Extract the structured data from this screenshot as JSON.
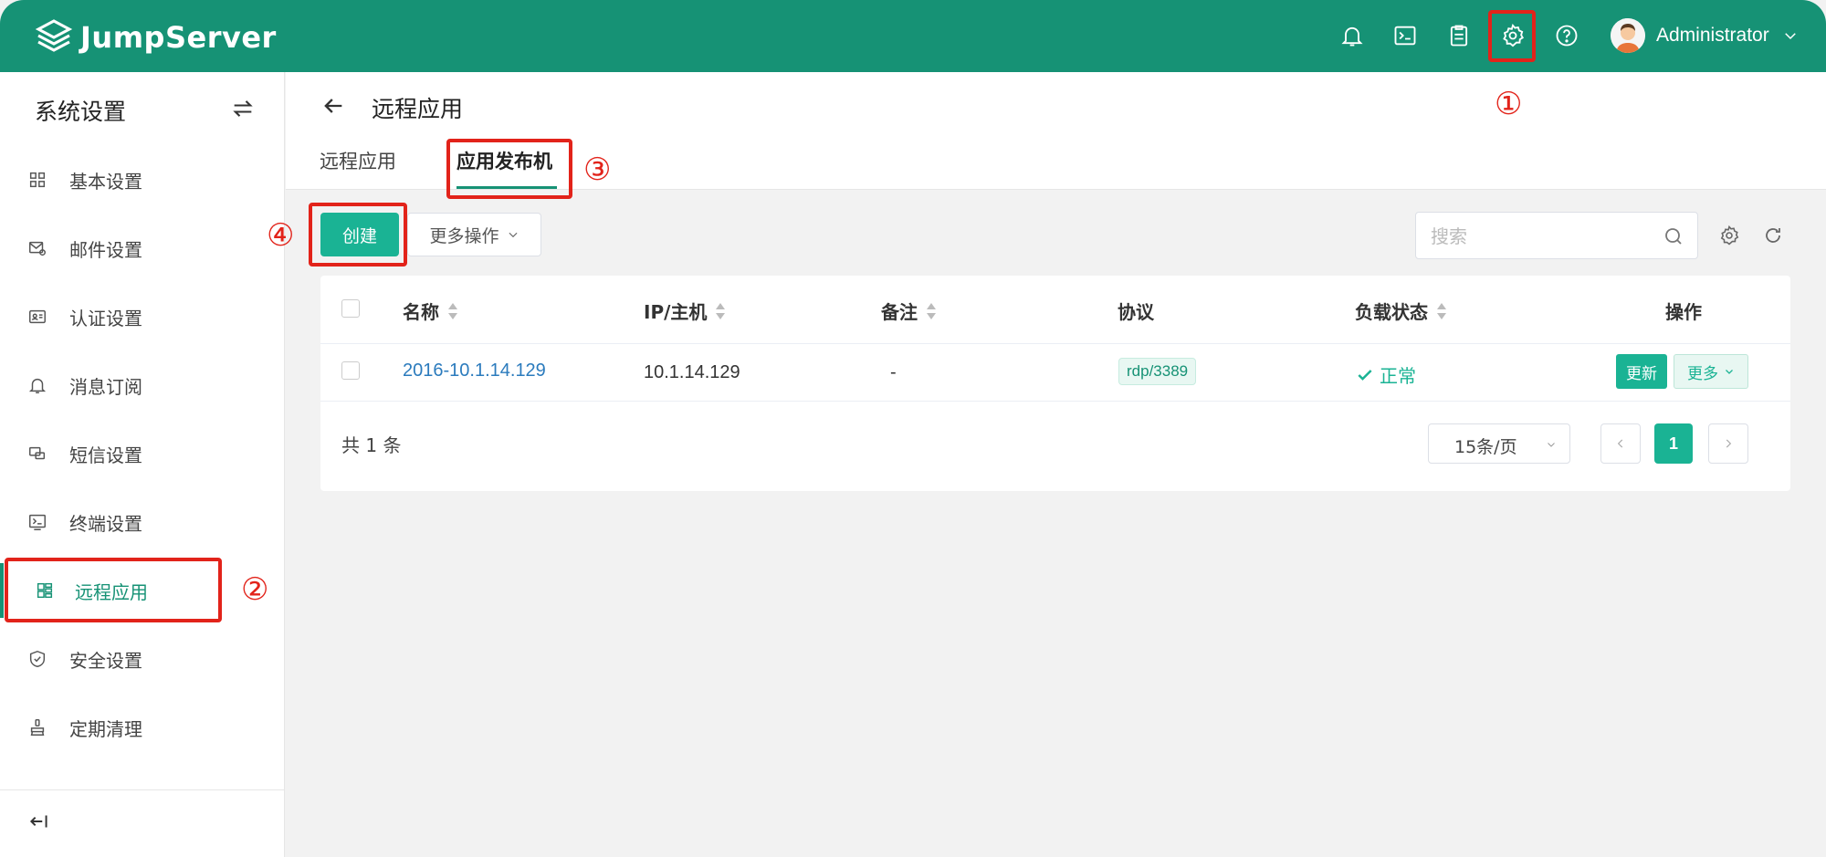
{
  "app": {
    "name": "JumpServer"
  },
  "user": {
    "name": "Administrator"
  },
  "sidebar": {
    "title": "系统设置",
    "items": [
      {
        "label": "基本设置",
        "icon": "grid-icon"
      },
      {
        "label": "邮件设置",
        "icon": "mail-settings-icon"
      },
      {
        "label": "认证设置",
        "icon": "id-card-icon"
      },
      {
        "label": "消息订阅",
        "icon": "bell-icon"
      },
      {
        "label": "短信设置",
        "icon": "message-icon"
      },
      {
        "label": "终端设置",
        "icon": "terminal-icon"
      },
      {
        "label": "远程应用",
        "icon": "apps-icon",
        "active": true
      },
      {
        "label": "安全设置",
        "icon": "shield-icon"
      },
      {
        "label": "定期清理",
        "icon": "clean-icon"
      }
    ]
  },
  "page": {
    "title": "远程应用",
    "tabs": [
      {
        "label": "远程应用"
      },
      {
        "label": "应用发布机",
        "active": true
      }
    ]
  },
  "toolbar": {
    "create_label": "创建",
    "more_actions_label": "更多操作",
    "search_placeholder": "搜索"
  },
  "table": {
    "headers": {
      "name": "名称",
      "ip": "IP/主机",
      "comment": "备注",
      "protocol": "协议",
      "load_status": "负载状态",
      "actions": "操作"
    },
    "rows": [
      {
        "name": "2016-10.1.14.129",
        "ip": "10.1.14.129",
        "comment": "-",
        "protocol": "rdp/3389",
        "load_status": "正常",
        "update_label": "更新",
        "more_label": "更多"
      }
    ]
  },
  "pagination": {
    "total_text": "共 1 条",
    "page_size": "15条/页",
    "current_page": "1"
  },
  "annotations": {
    "step1": "①",
    "step2": "②",
    "step3": "③",
    "step4": "④"
  },
  "colors": {
    "brand": "#169275",
    "accent": "#1ab394",
    "link": "#2b7bbd",
    "annotation": "#e2231a"
  }
}
